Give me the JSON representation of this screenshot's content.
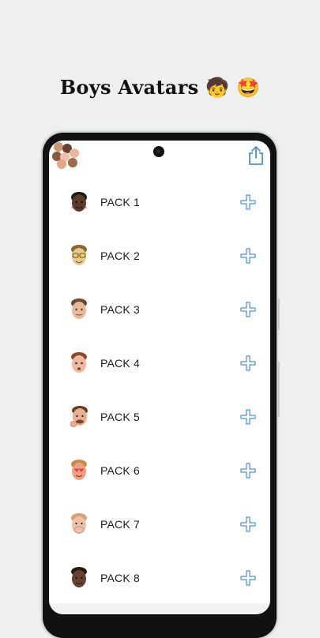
{
  "promo": {
    "title": "Boys Avatars",
    "emojis": "🧒 🤩"
  },
  "toolbar": {
    "share_icon": "share-icon",
    "accent": "#4a90d9"
  },
  "packs": [
    {
      "label": "PACK 1",
      "skin": "#5a3a28",
      "hair": "#1a1a1a",
      "accent": "#d93636"
    },
    {
      "label": "PACK 2",
      "skin": "#e8c98a",
      "hair": "#8a6a2a",
      "accent": "#f2d25a"
    },
    {
      "label": "PACK 3",
      "skin": "#e8b89a",
      "hair": "#6a4a30",
      "accent": "#e8b89a"
    },
    {
      "label": "PACK 4",
      "skin": "#f0b8a0",
      "hair": "#8a4a2a",
      "accent": "#f0b8a0"
    },
    {
      "label": "PACK 5",
      "skin": "#e8b090",
      "hair": "#6a3a1a",
      "accent": "#e8b090"
    },
    {
      "label": "PACK 6",
      "skin": "#f0a080",
      "hair": "#c88a4a",
      "accent": "#e83a3a"
    },
    {
      "label": "PACK 7",
      "skin": "#f0c0a8",
      "hair": "#d8a070",
      "accent": "#f0c0a8"
    },
    {
      "label": "PACK 8",
      "skin": "#6a4030",
      "hair": "#2a1a10",
      "accent": "#6a4030"
    }
  ]
}
